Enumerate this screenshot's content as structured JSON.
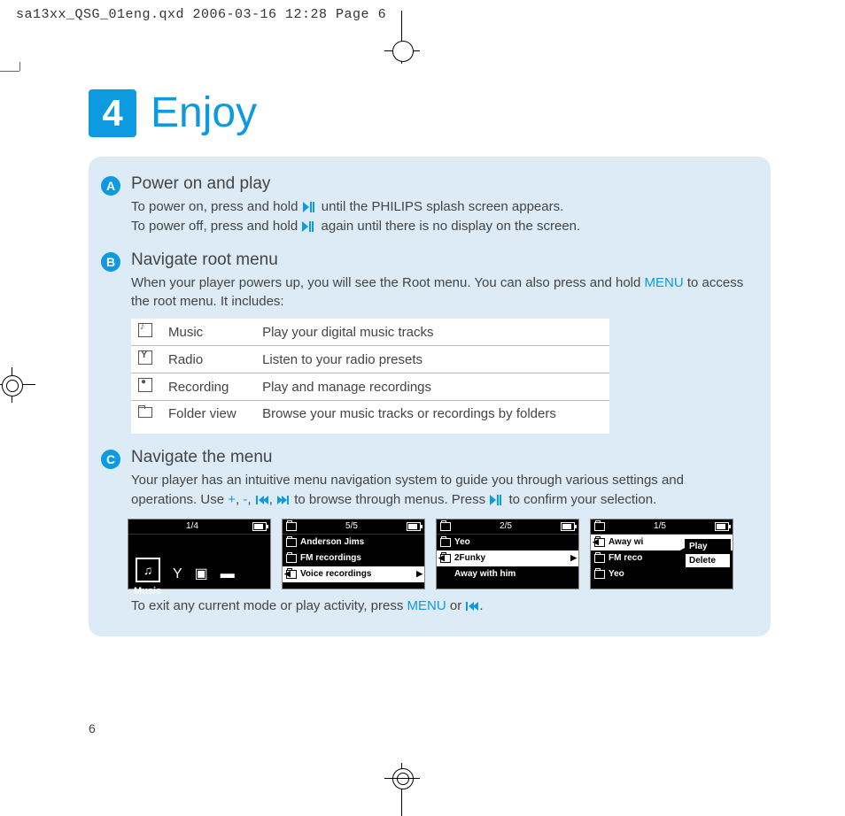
{
  "crop_header": "sa13xx_QSG_01eng.qxd  2006-03-16  12:28  Page 6",
  "step_number": "4",
  "title": "Enjoy",
  "page_number": "6",
  "sections": {
    "A": {
      "bullet": "A",
      "heading": "Power on and play",
      "line1_a": "To power on, press and hold ",
      "line1_b": " until the PHILIPS splash screen appears.",
      "line2_a": "To power off, press and hold ",
      "line2_b": " again until there is no display on the screen."
    },
    "B": {
      "bullet": "B",
      "heading": "Navigate root menu",
      "text_a": "When your player powers up, you will see the Root menu. You can also press and hold ",
      "menu_kw": "MENU",
      "text_b": " to access the root menu. It includes:",
      "table": [
        {
          "name": "Music",
          "desc": "Play your digital music tracks"
        },
        {
          "name": "Radio",
          "desc": "Listen to your radio presets"
        },
        {
          "name": "Recording",
          "desc": "Play and manage recordings"
        },
        {
          "name": "Folder view",
          "desc": "Browse your music tracks or recordings by folders"
        }
      ]
    },
    "C": {
      "bullet": "C",
      "heading": "Navigate the menu",
      "text_a": "Your player has an intuitive menu navigation system to guide you through various settings and operations. Use ",
      "plus": "+",
      "sep": ", ",
      "minus": "-",
      "text_b": " to browse through menus. Press ",
      "text_c": " to confirm your selection.",
      "exit_a": "To exit any current mode or play activity, press ",
      "menu_kw": "MENU",
      "exit_b": " or ",
      "exit_c": "."
    }
  },
  "screens": {
    "s1": {
      "count": "1/4",
      "label": "Music"
    },
    "s2": {
      "count": "5/5",
      "rows": [
        "Anderson Jims",
        "FM recordings",
        "Voice recordings"
      ]
    },
    "s3": {
      "count": "2/5",
      "rows": [
        "Yeo",
        "2Funky",
        "Away with him"
      ]
    },
    "s4": {
      "count": "1/5",
      "rows": [
        "Away wi",
        "FM reco",
        "Yeo"
      ],
      "popup": [
        "Play",
        "Delete"
      ]
    }
  }
}
